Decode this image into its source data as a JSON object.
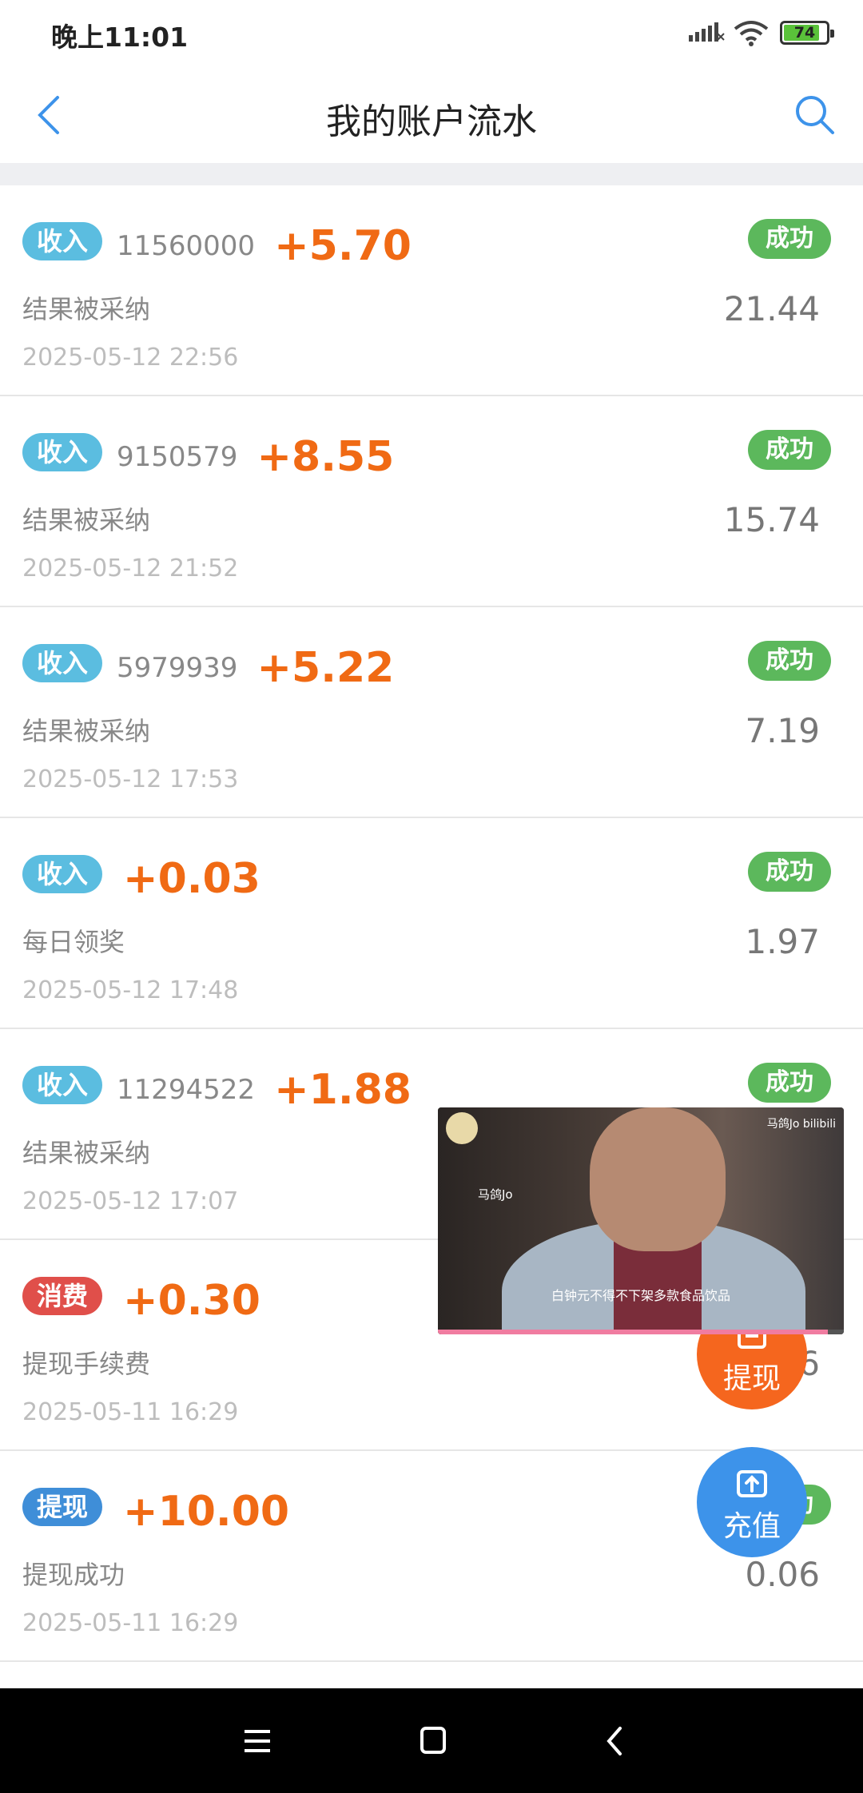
{
  "status_bar": {
    "time": "晚上11:01",
    "battery": "74"
  },
  "header": {
    "title": "我的账户流水"
  },
  "transactions": [
    {
      "badge": "收入",
      "badge_type": "income",
      "order": "11560000",
      "amount": "+5.70",
      "desc": "结果被采纳",
      "date": "2025-05-12 22:56",
      "status": "成功",
      "balance": "21.44"
    },
    {
      "badge": "收入",
      "badge_type": "income",
      "order": "9150579",
      "amount": "+8.55",
      "desc": "结果被采纳",
      "date": "2025-05-12 21:52",
      "status": "成功",
      "balance": "15.74"
    },
    {
      "badge": "收入",
      "badge_type": "income",
      "order": "5979939",
      "amount": "+5.22",
      "desc": "结果被采纳",
      "date": "2025-05-12 17:53",
      "status": "成功",
      "balance": "7.19"
    },
    {
      "badge": "收入",
      "badge_type": "income",
      "order": "",
      "amount": "+0.03",
      "desc": "每日领奖",
      "date": "2025-05-12 17:48",
      "status": "成功",
      "balance": "1.97"
    },
    {
      "badge": "收入",
      "badge_type": "income",
      "order": "11294522",
      "amount": "+1.88",
      "desc": "结果被采纳",
      "date": "2025-05-12 17:07",
      "status": "成功",
      "balance": ""
    },
    {
      "badge": "消费",
      "badge_type": "expense",
      "order": "",
      "amount": "+0.30",
      "desc": "提现手续费",
      "date": "2025-05-11 16:29",
      "status": "",
      "balance": "6"
    },
    {
      "badge": "提现",
      "badge_type": "withdraw",
      "order": "",
      "amount": "+10.00",
      "desc": "提现成功",
      "date": "2025-05-11 16:29",
      "status": "功",
      "balance": "0.06"
    }
  ],
  "video": {
    "name": "马鸽Jo",
    "brand": "马鸽Jo bilibili",
    "subtitle": "白钟元不得不下架多款食品饮品",
    "progress": 0.96
  },
  "fabs": {
    "withdraw_label": "提现",
    "recharge_label": "充值"
  },
  "colors": {
    "accent": "#f06a14",
    "success": "#5cb85c",
    "income": "#5bbde0",
    "expense": "#e04f4a",
    "withdraw": "#3f8ed8",
    "primary": "#3d93ea"
  }
}
